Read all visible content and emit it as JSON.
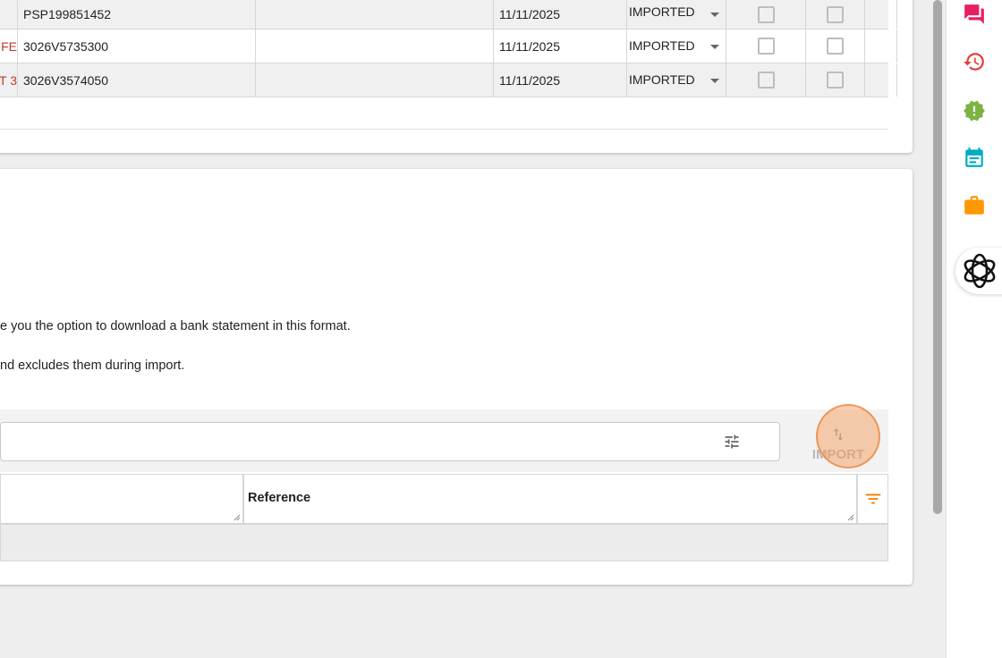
{
  "table": {
    "rows": [
      {
        "name": "",
        "reference": "PSP199851452",
        "blank": "",
        "date": "11/11/2025",
        "status": "IMPORTED",
        "alt": true
      },
      {
        "name": "FE",
        "reference": "3026V5735300",
        "blank": "",
        "date": "11/11/2025",
        "status": "IMPORTED",
        "alt": false
      },
      {
        "name": "T 3",
        "reference": "3026V3574050",
        "blank": "",
        "date": "11/11/2025",
        "status": "IMPORTED",
        "alt": true
      }
    ]
  },
  "info": {
    "line1": "e you the option to download a bank statement in this format.",
    "line2": "nd excludes them during import."
  },
  "import_bar": {
    "search_value": "",
    "import_label": "IMPORT"
  },
  "filters": {
    "col1_label": "",
    "col2_label": "Reference"
  },
  "colors": {
    "accent_orange": "#f57c00",
    "name_red": "#c0392b",
    "chat_pink": "#e91e63",
    "history_red": "#e53935",
    "alert_green": "#7cb342",
    "calendar_cyan": "#00acc1",
    "briefcase_orange": "#ff9800"
  },
  "sidebar": {
    "icons": [
      "chat-icon",
      "history-icon",
      "alert-badge-icon",
      "calendar-icon",
      "briefcase-icon",
      "ai-assistant-icon"
    ]
  }
}
